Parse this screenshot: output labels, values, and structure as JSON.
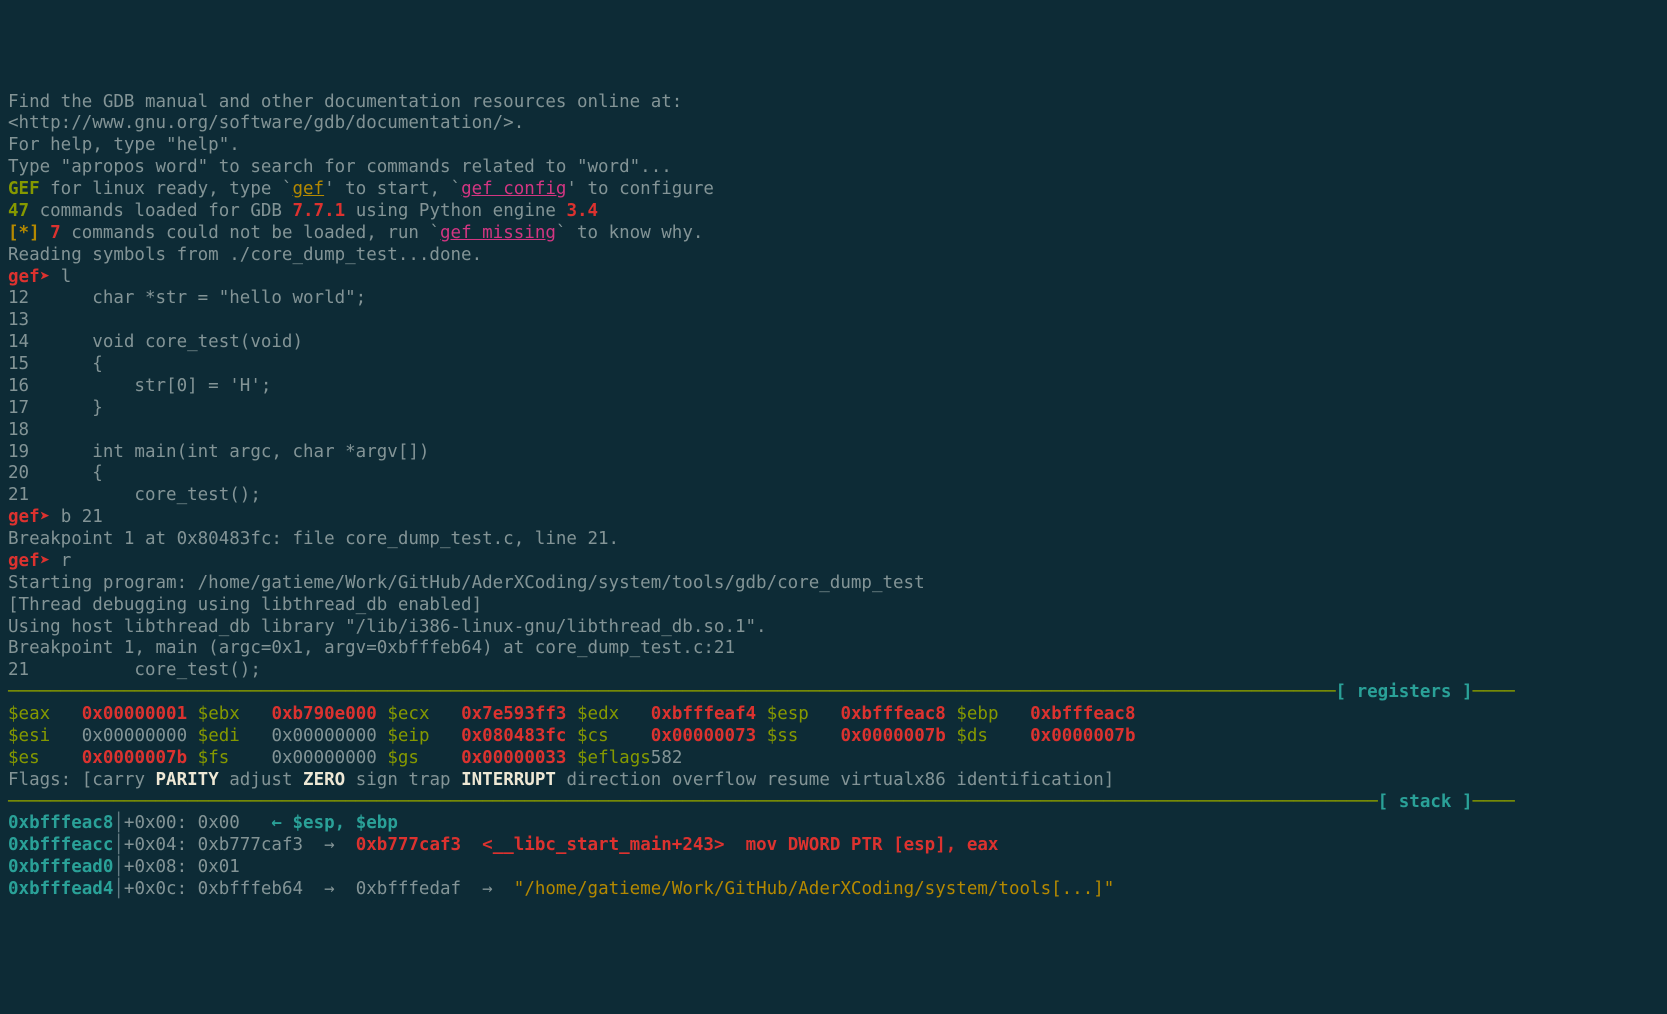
{
  "intro": {
    "line1": "Find the GDB manual and other documentation resources online at:",
    "line2": "<http://www.gnu.org/software/gdb/documentation/>.",
    "line3": "For help, type \"help\".",
    "line4": "Type \"apropos word\" to search for commands related to \"word\"..."
  },
  "gef_ready": {
    "gef": "GEF",
    "text1": " for linux ready, type `",
    "cmd1": "gef",
    "text2": "' to start, `",
    "cmd2": "gef config",
    "text3": "' to configure"
  },
  "loaded": {
    "count": "47",
    "text1": " commands loaded for GDB ",
    "ver": "7.7.1",
    "text2": " using Python engine ",
    "pyver": "3.4"
  },
  "missing": {
    "marker": "[*]",
    "count": "7",
    "text1": " commands could not be loaded, run `",
    "cmd": "gef missing",
    "text2": "` to know why."
  },
  "reading": "Reading symbols from ./core_dump_test...done.",
  "prompt": {
    "gef": "gef",
    "arrow": "➤"
  },
  "cmd_l": " l",
  "src": {
    "l12": "12      char *str = \"hello world\";",
    "l13": "13",
    "l14": "14      void core_test(void)",
    "l15": "15      {",
    "l16": "16          str[0] = 'H';",
    "l17": "17      }",
    "l18": "18",
    "l19": "19      int main(int argc, char *argv[])",
    "l20": "20      {",
    "l21": "21          core_test();"
  },
  "cmd_b": " b 21",
  "bp_set": "Breakpoint 1 at 0x80483fc: file core_dump_test.c, line 21.",
  "cmd_r": " r",
  "starting": "Starting program: /home/gatieme/Work/GitHub/AderXCoding/system/tools/gdb/core_dump_test",
  "thread_dbg": "[Thread debugging using libthread_db enabled]",
  "using_lib": "Using host libthread_db library \"/lib/i386-linux-gnu/libthread_db.so.1\".",
  "bp_hit": "Breakpoint 1, main (argc=0x1, argv=0xbfffeb64) at core_dump_test.c:21",
  "bp_line": "21          core_test();",
  "hr_reg_left": "──────────────────────────────────────────────────────────────────────────────────────────────────────────────────────────────",
  "hr_reg_label": "[ registers ]",
  "hr_reg_right": "────",
  "regs": {
    "eax": "$eax",
    "eax_v": "0x00000001",
    "ebx": "$ebx",
    "ebx_v": "0xb790e000",
    "ecx": "$ecx",
    "ecx_v": "0x7e593ff3",
    "edx": "$edx",
    "edx_v": "0xbfffeaf4",
    "esp": "$esp",
    "esp_v": "0xbfffeac8",
    "ebp": "$ebp",
    "ebp_v": "0xbfffeac8",
    "esi": "$esi",
    "esi_v": "0x00000000",
    "edi": "$edi",
    "edi_v": "0x00000000",
    "eip": "$eip",
    "eip_v": "0x080483fc",
    "cs": "$cs",
    "cs_v": "0x00000073",
    "ss": "$ss",
    "ss_v": "0x0000007b",
    "ds": "$ds",
    "ds_v": "0x0000007b",
    "es": "$es",
    "es_v": "0x0000007b",
    "fs": "$fs",
    "fs_v": "0x00000000",
    "gs": "$gs",
    "gs_v": "0x00000033",
    "eflags": "$eflags",
    "eflags_v": "582"
  },
  "flags": {
    "label": "Flags: [",
    "carry": "carry ",
    "parity": "PARITY",
    "adjust": " adjust ",
    "zero": "ZERO",
    "sign_trap": " sign trap ",
    "interrupt": "INTERRUPT",
    "rest": " direction overflow resume virtualx86 identification]"
  },
  "hr_stack_left": "──────────────────────────────────────────────────────────────────────────────────────────────────────────────────────────────────",
  "hr_stack_label": "[ stack ]",
  "hr_stack_right": "────",
  "stack": {
    "r0": {
      "addr": "0xbfffeac8",
      "off": "+0x00:",
      "val": "0x00",
      "arrow_l": "←",
      "annot": "$esp, $ebp"
    },
    "r1": {
      "addr": "0xbfffeacc",
      "off": "+0x04:",
      "val": "0xb777caf3",
      "arrow_r": "→",
      "deref": "0xb777caf3",
      "sym": "<__libc_start_main+243>",
      "asm": "mov DWORD PTR [esp], eax"
    },
    "r2": {
      "addr": "0xbfffead0",
      "off": "+0x08:",
      "val": "0x01"
    },
    "r3": {
      "addr": "0xbfffead4",
      "off": "+0x0c:",
      "val": "0xbfffeb64",
      "arrow_r1": "→",
      "deref1": "0xbfffedaf",
      "arrow_r2": "→",
      "str": "\"/home/gatieme/Work/GitHub/AderXCoding/system/tools[...]\""
    }
  }
}
